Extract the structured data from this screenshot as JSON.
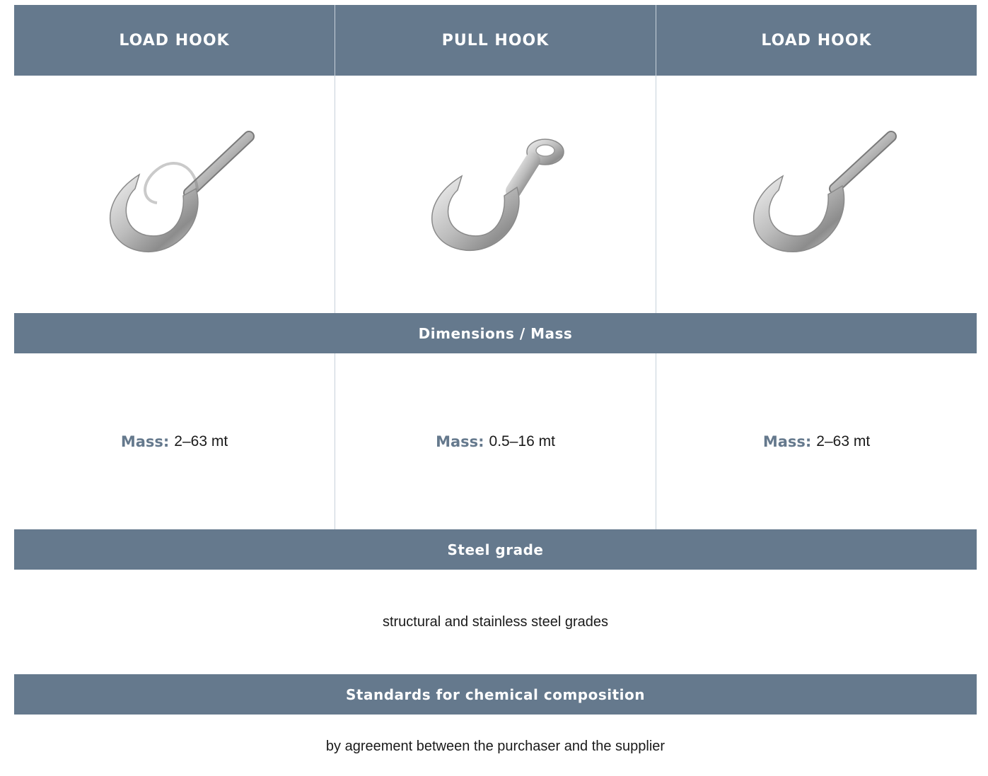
{
  "header": {
    "columns": [
      "LOAD HOOK",
      "PULL HOOK",
      "LOAD HOOK"
    ]
  },
  "images": [
    {
      "icon": "load-hook-image"
    },
    {
      "icon": "pull-hook-image"
    },
    {
      "icon": "load-hook-image"
    }
  ],
  "dimensions": {
    "title": "Dimensions / Mass",
    "mass_label": "Mass:",
    "values": [
      "2–63 mt",
      "0.5–16 mt",
      "2–63 mt"
    ]
  },
  "steel": {
    "title": "Steel grade",
    "text": "structural and stainless steel grades"
  },
  "standards": {
    "title": "Standards for chemical composition",
    "text": "by agreement between the purchaser and the supplier"
  },
  "colors": {
    "header_bg": "#65798d",
    "accent": "#65798d",
    "divider": "#c7d1da"
  }
}
